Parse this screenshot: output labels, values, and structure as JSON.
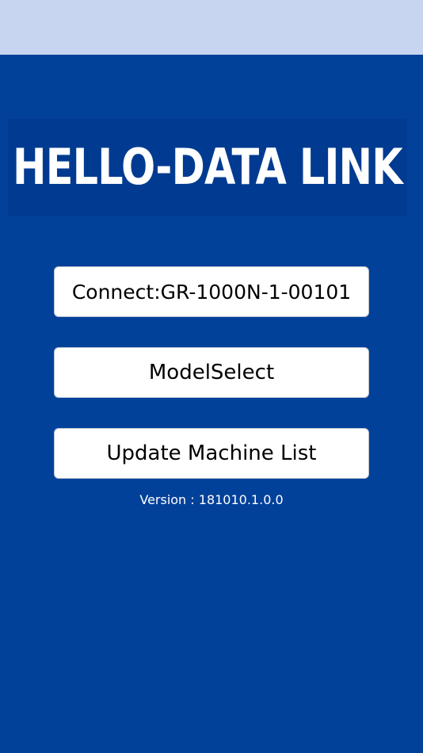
{
  "logo": {
    "text": "HELLO-DATA LINK"
  },
  "buttons": {
    "connect_label": "Connect:GR-1000N-1-00101",
    "model_select_label": "ModelSelect",
    "update_machine_list_label": "Update Machine List"
  },
  "version_text": "Version : 181010.1.0.0",
  "colors": {
    "status_bar": "#c8d5f0",
    "background": "#02419a",
    "logo_banner": "#003b91",
    "button_bg": "#ffffff",
    "text_light": "#ffffff"
  }
}
